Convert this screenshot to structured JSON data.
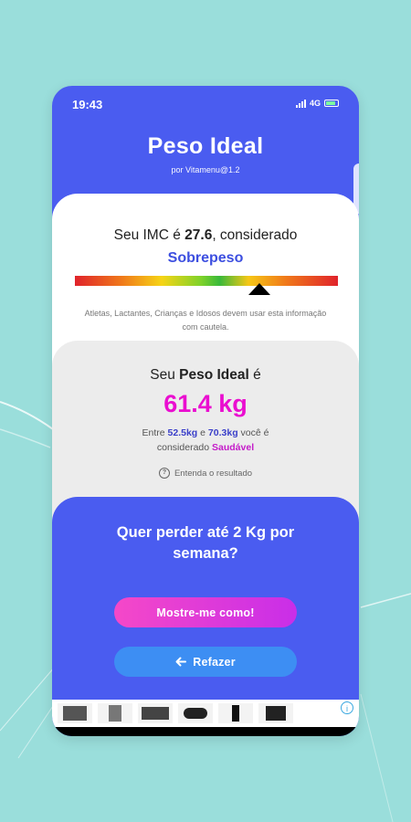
{
  "status_bar": {
    "time": "19:43",
    "network": "4G"
  },
  "header": {
    "title": "Peso Ideal",
    "subtitle": "por Vitamenu@1.2"
  },
  "imc": {
    "prefix": "Seu IMC é ",
    "value": "27.6",
    "suffix": ", considerado",
    "classification": "Sobrepeso",
    "scale_position": 0.7
  },
  "warning": "Atletas, Lactantes, Crianças e Idosos devem usar esta informação com cautela.",
  "ideal": {
    "prefix": "Seu ",
    "label": "Peso Ideal",
    "suffix": " é",
    "value": "61.4 kg",
    "range_prefix": "Entre ",
    "range_min": "52.5kg",
    "range_middle": " e ",
    "range_max": "70.3kg",
    "range_suffix": " você é",
    "considered": "considerado ",
    "status": "Saudável",
    "understand_label": "Entenda o resultado"
  },
  "promo": {
    "question": "Quer perder até 2 Kg por semana?",
    "show_button": "Mostre-me como!",
    "redo_button": "Refazer"
  },
  "colors": {
    "background": "#9adedb",
    "primary": "#4a5cf0",
    "ideal_value": "#ea0ed0",
    "classification": "#3d4fe0",
    "button_show": "#e23ed8",
    "button_redo": "#3d8ef3"
  },
  "icons": [
    "signal-icon",
    "battery-icon",
    "question-circle-icon",
    "arrow-left-icon",
    "ad-info-icon"
  ]
}
